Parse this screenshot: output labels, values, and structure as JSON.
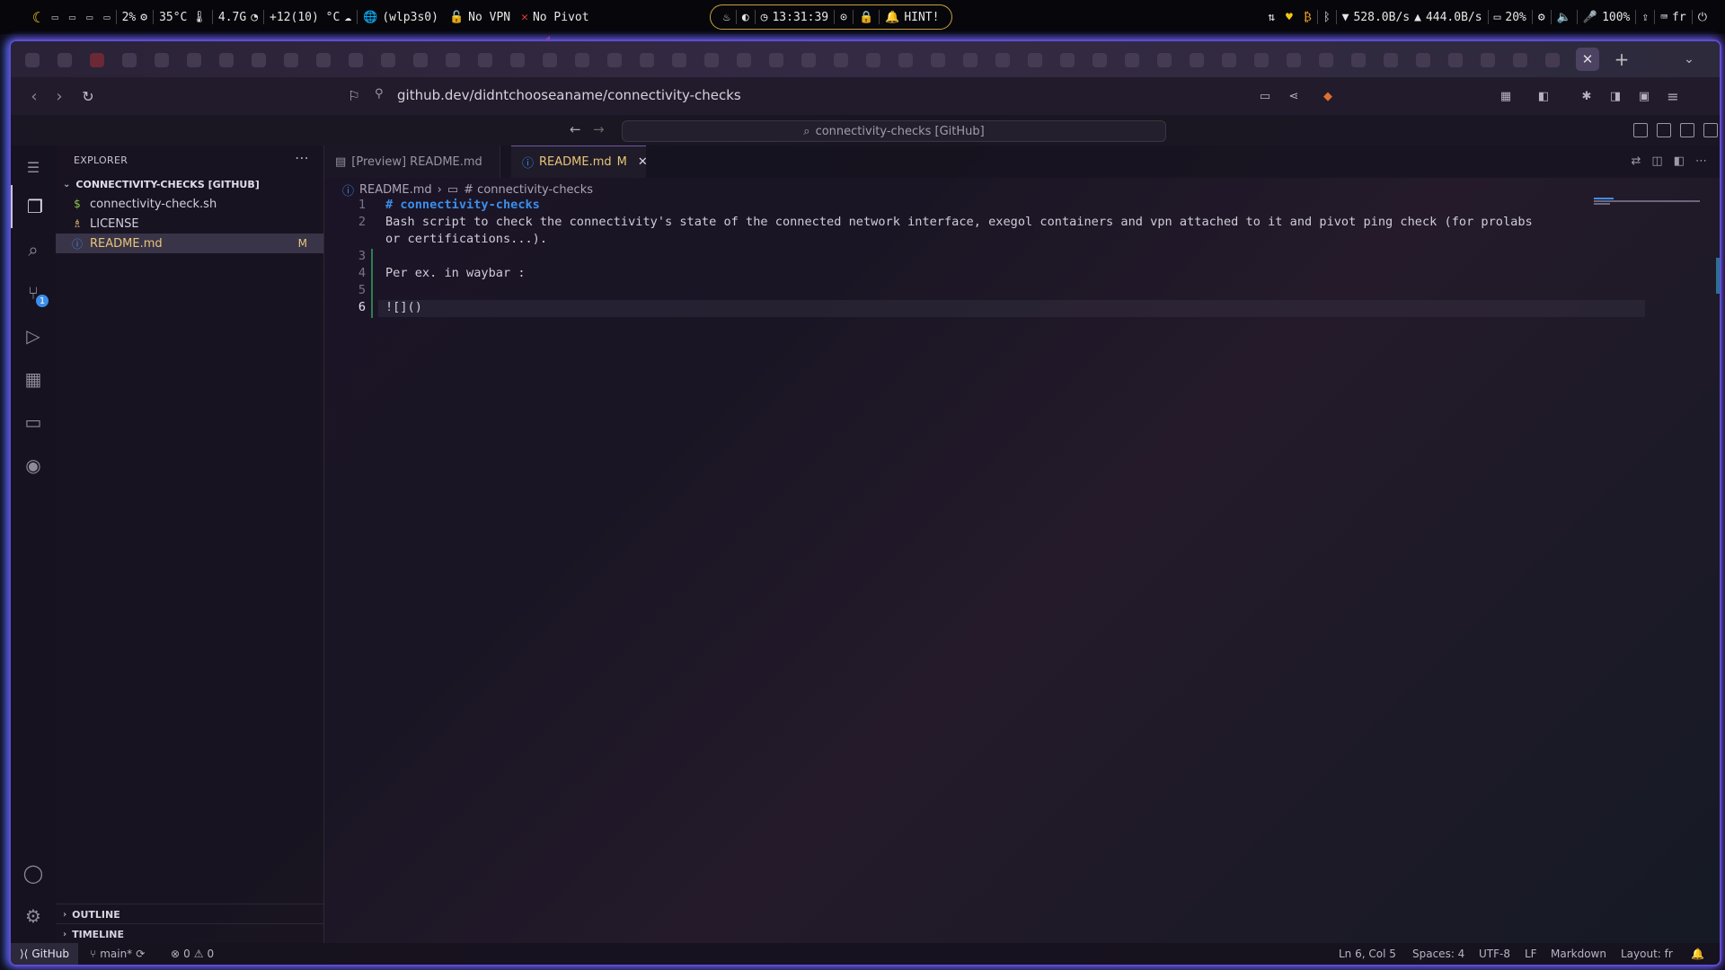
{
  "waybar": {
    "cpu": "2%",
    "temp": "35°C",
    "memory": "4.7G",
    "weather": "+12(10) °C",
    "interface": "(wlp3s0)",
    "vpn": "No VPN",
    "pivot": "No Pivot",
    "clock": "13:31:39",
    "hint": "HINT!",
    "net_down": "528.0B/s",
    "net_up": "444.0B/s",
    "battery": "20%",
    "volume": "100%",
    "keyboard": "fr"
  },
  "browser": {
    "url": "github.dev/didntchooseaname/connectivity-checks"
  },
  "vscode": {
    "command_center": "connectivity-checks [GitHub]",
    "sidebar": {
      "title": "EXPLORER",
      "repo": "CONNECTIVITY-CHECKS [GITHUB]",
      "files": [
        {
          "name": "connectivity-check.sh",
          "icon": "shell-script-icon",
          "modified": ""
        },
        {
          "name": "LICENSE",
          "icon": "license-icon",
          "modified": ""
        },
        {
          "name": "README.md",
          "icon": "info-icon",
          "modified": "M"
        }
      ],
      "sections": [
        "OUTLINE",
        "TIMELINE"
      ]
    },
    "tabs": [
      {
        "label": "[Preview] README.md"
      },
      {
        "label": "README.md",
        "status": "M"
      }
    ],
    "breadcrumb": [
      "README.md",
      "# connectivity-checks"
    ],
    "lines": [
      {
        "n": "1",
        "text": "# connectivity-checks"
      },
      {
        "n": "2",
        "text": "Bash script to check the connectivity's state of the connected network interface, exegol containers and vpn attached to it and pivot ping check (for prolabs"
      },
      {
        "n": "",
        "text": "or certifications...)."
      },
      {
        "n": "3",
        "text": ""
      },
      {
        "n": "4",
        "text": "Per ex. in waybar :"
      },
      {
        "n": "5",
        "text": ""
      },
      {
        "n": "6",
        "text": "![]()"
      }
    ],
    "status": {
      "remote": "GitHub",
      "branch": "main*",
      "errors": "0",
      "warnings": "0",
      "position": "Ln 6, Col 5",
      "spaces": "Spaces: 4",
      "encoding": "UTF-8",
      "eol": "LF",
      "language": "Markdown",
      "layout": "Layout: fr"
    },
    "source_control_badge": "1"
  },
  "colors": {
    "accent": "#3b8eea",
    "modified": "#e8c57a",
    "error": "#e03a3a"
  }
}
